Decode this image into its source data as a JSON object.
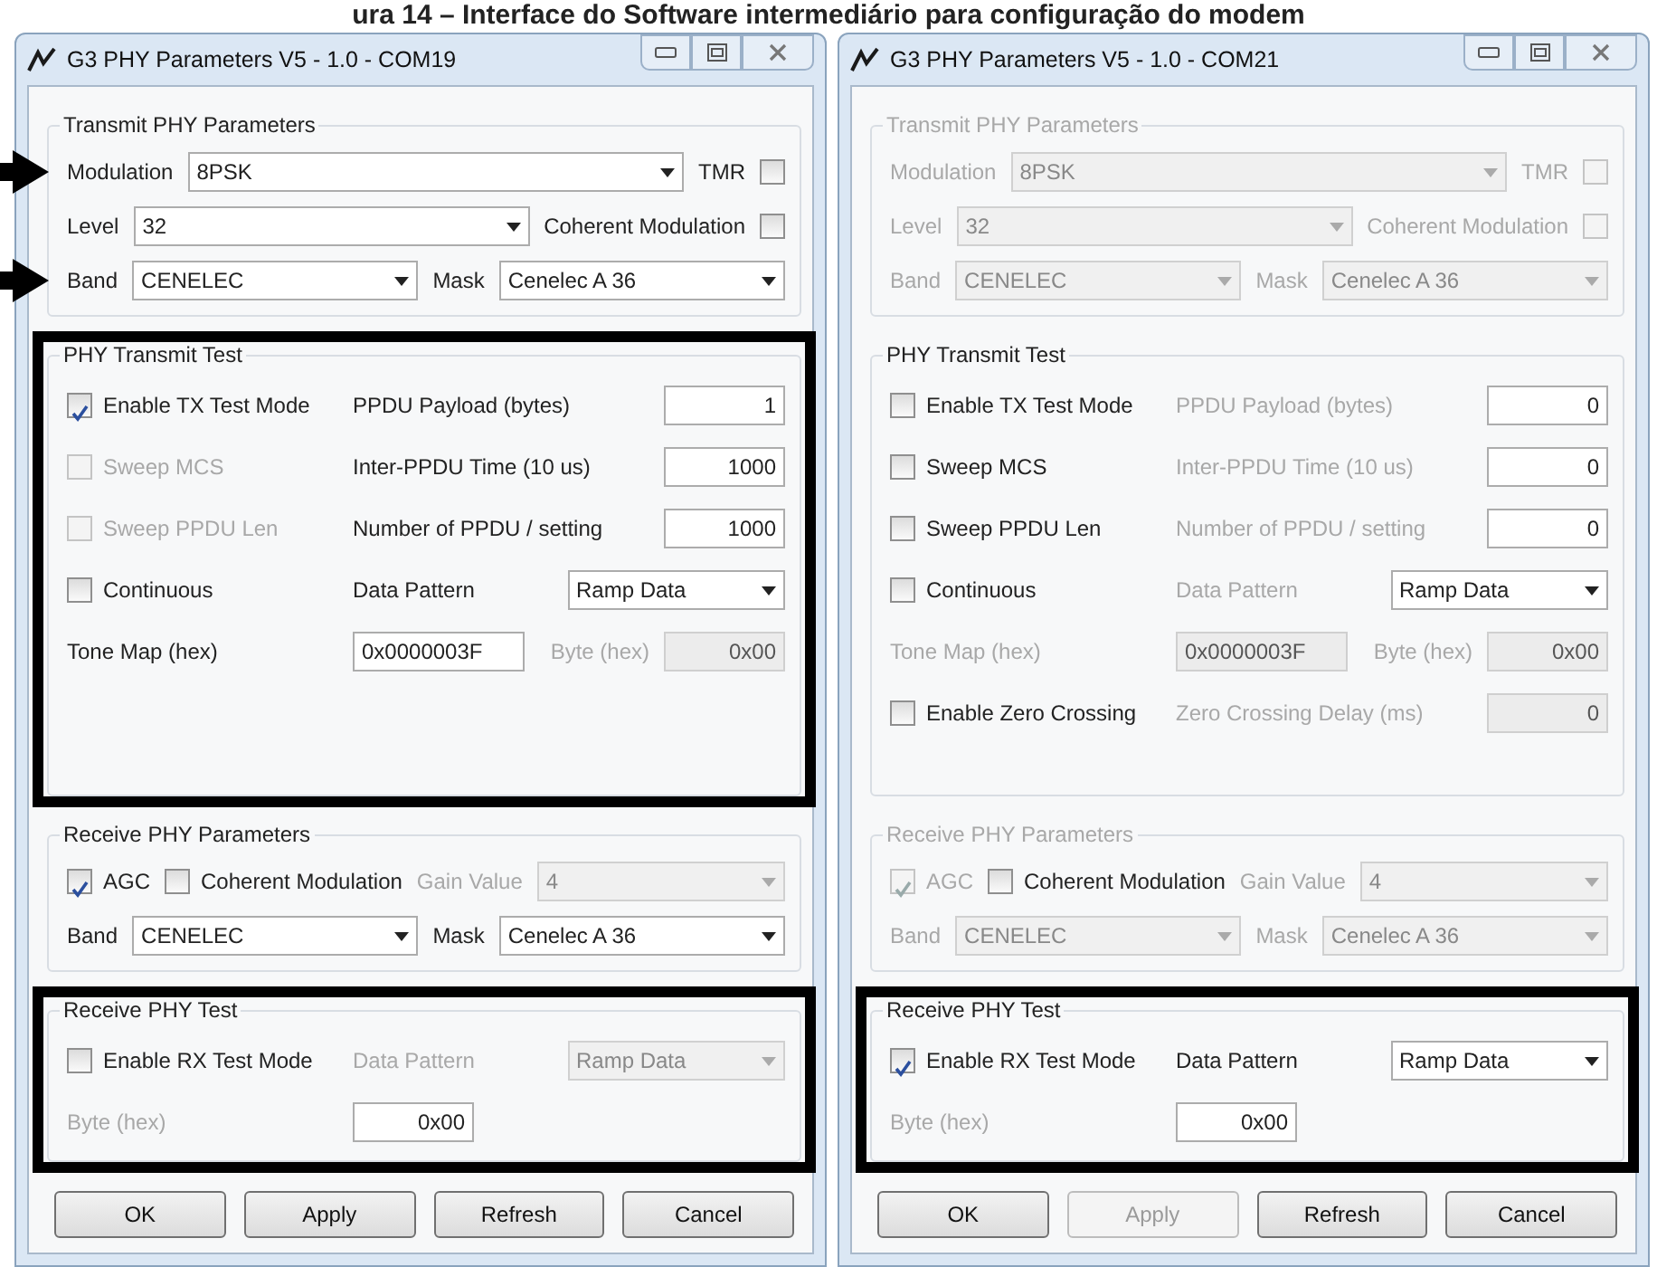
{
  "caption": "ura 14 – Interface do Software intermediário para configuração do modem",
  "windows": [
    {
      "title": "G3 PHY Parameters V5  - 1.0 - COM19",
      "groups": [
        {
          "title": "Transmit PHY Parameters",
          "title_disabled": false,
          "highlighted": false,
          "rows": [
            {
              "pointer": true,
              "items": [
                {
                  "kind": "label",
                  "text": "Modulation",
                  "disabled": false
                },
                {
                  "kind": "combo",
                  "value": "8PSK",
                  "disabled": false
                },
                {
                  "kind": "checkbox",
                  "text": "TMR",
                  "label_first": true,
                  "checked": false,
                  "disabled": false
                }
              ]
            },
            {
              "pointer": false,
              "items": [
                {
                  "kind": "label",
                  "text": "Level",
                  "disabled": false
                },
                {
                  "kind": "combo",
                  "value": "32",
                  "disabled": false
                },
                {
                  "kind": "checkbox",
                  "text": "Coherent Modulation",
                  "label_first": true,
                  "checked": false,
                  "disabled": false
                }
              ]
            },
            {
              "pointer": true,
              "items": [
                {
                  "kind": "label",
                  "text": "Band",
                  "disabled": false
                },
                {
                  "kind": "combo",
                  "value": "CENELEC",
                  "disabled": false
                },
                {
                  "kind": "label",
                  "text": "Mask",
                  "disabled": false
                },
                {
                  "kind": "combo",
                  "value": "Cenelec A 36",
                  "disabled": false
                }
              ]
            }
          ]
        },
        {
          "title": "PHY Transmit Test",
          "title_disabled": false,
          "highlighted": true,
          "rows": [
            {
              "items": [
                {
                  "kind": "checkbox",
                  "text": "Enable TX Test Mode",
                  "label_first": false,
                  "checked": true,
                  "disabled": false
                },
                {
                  "kind": "label",
                  "text": "PPDU Payload (bytes)",
                  "disabled": false
                },
                {
                  "kind": "textbox",
                  "value": "1",
                  "disabled": false
                }
              ]
            },
            {
              "items": [
                {
                  "kind": "checkbox",
                  "text": "Sweep MCS",
                  "label_first": false,
                  "checked": false,
                  "disabled": true
                },
                {
                  "kind": "label",
                  "text": "Inter-PPDU Time (10 us)",
                  "disabled": false
                },
                {
                  "kind": "textbox",
                  "value": "1000",
                  "disabled": false
                }
              ]
            },
            {
              "items": [
                {
                  "kind": "checkbox",
                  "text": "Sweep PPDU Len",
                  "label_first": false,
                  "checked": false,
                  "disabled": true
                },
                {
                  "kind": "label",
                  "text": "Number of PPDU / setting",
                  "disabled": false
                },
                {
                  "kind": "textbox",
                  "value": "1000",
                  "disabled": false
                }
              ]
            },
            {
              "items": [
                {
                  "kind": "checkbox",
                  "text": "Continuous",
                  "label_first": false,
                  "checked": false,
                  "disabled": false
                },
                {
                  "kind": "label",
                  "text": "Data Pattern",
                  "disabled": false
                },
                {
                  "kind": "combo",
                  "value": "Ramp Data",
                  "disabled": false
                }
              ]
            },
            {
              "items": [
                {
                  "kind": "label",
                  "text": "Tone Map (hex)",
                  "disabled": false
                },
                {
                  "kind": "textbox",
                  "value": "0x0000003F",
                  "disabled": false
                },
                {
                  "kind": "label",
                  "text": "Byte (hex)",
                  "disabled": true
                },
                {
                  "kind": "textbox",
                  "value": "0x00",
                  "disabled": true
                }
              ]
            }
          ]
        },
        {
          "title": "Receive PHY Parameters",
          "title_disabled": false,
          "highlighted": false,
          "rows": [
            {
              "items": [
                {
                  "kind": "checkbox",
                  "text": "AGC",
                  "label_first": false,
                  "checked": true,
                  "disabled": false
                },
                {
                  "kind": "checkbox",
                  "text": "Coherent Modulation",
                  "label_first": false,
                  "checked": false,
                  "disabled": false
                },
                {
                  "kind": "label",
                  "text": "Gain Value",
                  "disabled": true
                },
                {
                  "kind": "combo",
                  "value": "4",
                  "disabled": true
                }
              ]
            },
            {
              "items": [
                {
                  "kind": "label",
                  "text": "Band",
                  "disabled": false
                },
                {
                  "kind": "combo",
                  "value": "CENELEC",
                  "disabled": false
                },
                {
                  "kind": "label",
                  "text": "Mask",
                  "disabled": false
                },
                {
                  "kind": "combo",
                  "value": "Cenelec A 36",
                  "disabled": false
                }
              ]
            }
          ]
        },
        {
          "title": "Receive PHY Test",
          "title_disabled": false,
          "highlighted": true,
          "rows": [
            {
              "items": [
                {
                  "kind": "checkbox",
                  "text": "Enable RX Test Mode",
                  "label_first": false,
                  "checked": false,
                  "disabled": false
                },
                {
                  "kind": "label",
                  "text": "Data Pattern",
                  "disabled": true
                },
                {
                  "kind": "combo",
                  "value": "Ramp Data",
                  "disabled": true
                }
              ]
            },
            {
              "items": [
                {
                  "kind": "label",
                  "text": "Byte (hex)",
                  "disabled": true
                },
                {
                  "kind": "textbox",
                  "value": "0x00",
                  "disabled": false
                }
              ]
            }
          ]
        }
      ],
      "buttons": [
        {
          "label": "OK",
          "disabled": false
        },
        {
          "label": "Apply",
          "disabled": false
        },
        {
          "label": "Refresh",
          "disabled": false
        },
        {
          "label": "Cancel",
          "disabled": false
        }
      ]
    },
    {
      "title": "G3 PHY Parameters V5  - 1.0 - COM21",
      "groups": [
        {
          "title": "Transmit PHY Parameters",
          "title_disabled": true,
          "highlighted": false,
          "rows": [
            {
              "pointer": false,
              "items": [
                {
                  "kind": "label",
                  "text": "Modulation",
                  "disabled": true
                },
                {
                  "kind": "combo",
                  "value": "8PSK",
                  "disabled": true
                },
                {
                  "kind": "checkbox",
                  "text": "TMR",
                  "label_first": true,
                  "checked": false,
                  "disabled": true
                }
              ]
            },
            {
              "pointer": false,
              "items": [
                {
                  "kind": "label",
                  "text": "Level",
                  "disabled": true
                },
                {
                  "kind": "combo",
                  "value": "32",
                  "disabled": true
                },
                {
                  "kind": "checkbox",
                  "text": "Coherent Modulation",
                  "label_first": true,
                  "checked": false,
                  "disabled": true
                }
              ]
            },
            {
              "pointer": false,
              "items": [
                {
                  "kind": "label",
                  "text": "Band",
                  "disabled": true
                },
                {
                  "kind": "combo",
                  "value": "CENELEC",
                  "disabled": true
                },
                {
                  "kind": "label",
                  "text": "Mask",
                  "disabled": true
                },
                {
                  "kind": "combo",
                  "value": "Cenelec A 36",
                  "disabled": true
                }
              ]
            }
          ]
        },
        {
          "title": "PHY Transmit Test",
          "title_disabled": false,
          "highlighted": false,
          "rows": [
            {
              "items": [
                {
                  "kind": "checkbox",
                  "text": "Enable TX Test Mode",
                  "label_first": false,
                  "checked": false,
                  "disabled": false
                },
                {
                  "kind": "label",
                  "text": "PPDU Payload (bytes)",
                  "disabled": true
                },
                {
                  "kind": "textbox",
                  "value": "0",
                  "disabled": false
                }
              ]
            },
            {
              "items": [
                {
                  "kind": "checkbox",
                  "text": "Sweep MCS",
                  "label_first": false,
                  "checked": false,
                  "disabled": false
                },
                {
                  "kind": "label",
                  "text": "Inter-PPDU Time (10 us)",
                  "disabled": true
                },
                {
                  "kind": "textbox",
                  "value": "0",
                  "disabled": false
                }
              ]
            },
            {
              "items": [
                {
                  "kind": "checkbox",
                  "text": "Sweep PPDU Len",
                  "label_first": false,
                  "checked": false,
                  "disabled": false
                },
                {
                  "kind": "label",
                  "text": "Number of PPDU / setting",
                  "disabled": true
                },
                {
                  "kind": "textbox",
                  "value": "0",
                  "disabled": false
                }
              ]
            },
            {
              "items": [
                {
                  "kind": "checkbox",
                  "text": "Continuous",
                  "label_first": false,
                  "checked": false,
                  "disabled": false
                },
                {
                  "kind": "label",
                  "text": "Data Pattern",
                  "disabled": true
                },
                {
                  "kind": "combo",
                  "value": "Ramp Data",
                  "disabled": false
                }
              ]
            },
            {
              "items": [
                {
                  "kind": "label",
                  "text": "Tone Map (hex)",
                  "disabled": true
                },
                {
                  "kind": "textbox",
                  "value": "0x0000003F",
                  "disabled": true
                },
                {
                  "kind": "label",
                  "text": "Byte (hex)",
                  "disabled": true
                },
                {
                  "kind": "textbox",
                  "value": "0x00",
                  "disabled": true
                }
              ]
            },
            {
              "items": [
                {
                  "kind": "checkbox",
                  "text": "Enable Zero Crossing",
                  "label_first": false,
                  "checked": false,
                  "disabled": false
                },
                {
                  "kind": "label",
                  "text": "Zero Crossing Delay (ms)",
                  "disabled": true
                },
                {
                  "kind": "textbox",
                  "value": "0",
                  "disabled": true
                }
              ]
            }
          ]
        },
        {
          "title": "Receive PHY Parameters",
          "title_disabled": true,
          "highlighted": false,
          "rows": [
            {
              "items": [
                {
                  "kind": "checkbox",
                  "text": "AGC",
                  "label_first": false,
                  "checked": true,
                  "disabled": true
                },
                {
                  "kind": "checkbox",
                  "text": "Coherent Modulation",
                  "label_first": false,
                  "checked": false,
                  "disabled": false
                },
                {
                  "kind": "label",
                  "text": "Gain Value",
                  "disabled": true
                },
                {
                  "kind": "combo",
                  "value": "4",
                  "disabled": true
                }
              ]
            },
            {
              "items": [
                {
                  "kind": "label",
                  "text": "Band",
                  "disabled": true
                },
                {
                  "kind": "combo",
                  "value": "CENELEC",
                  "disabled": true
                },
                {
                  "kind": "label",
                  "text": "Mask",
                  "disabled": true
                },
                {
                  "kind": "combo",
                  "value": "Cenelec A 36",
                  "disabled": true
                }
              ]
            }
          ]
        },
        {
          "title": "Receive PHY Test",
          "title_disabled": false,
          "highlighted": true,
          "rows": [
            {
              "items": [
                {
                  "kind": "checkbox",
                  "text": "Enable RX Test Mode",
                  "label_first": false,
                  "checked": true,
                  "disabled": false
                },
                {
                  "kind": "label",
                  "text": "Data Pattern",
                  "disabled": false
                },
                {
                  "kind": "combo",
                  "value": "Ramp Data",
                  "disabled": false
                }
              ]
            },
            {
              "items": [
                {
                  "kind": "label",
                  "text": "Byte (hex)",
                  "disabled": true
                },
                {
                  "kind": "textbox",
                  "value": "0x00",
                  "disabled": false
                }
              ]
            }
          ]
        }
      ],
      "buttons": [
        {
          "label": "OK",
          "disabled": false
        },
        {
          "label": "Apply",
          "disabled": true
        },
        {
          "label": "Refresh",
          "disabled": false
        },
        {
          "label": "Cancel",
          "disabled": false
        }
      ]
    }
  ]
}
